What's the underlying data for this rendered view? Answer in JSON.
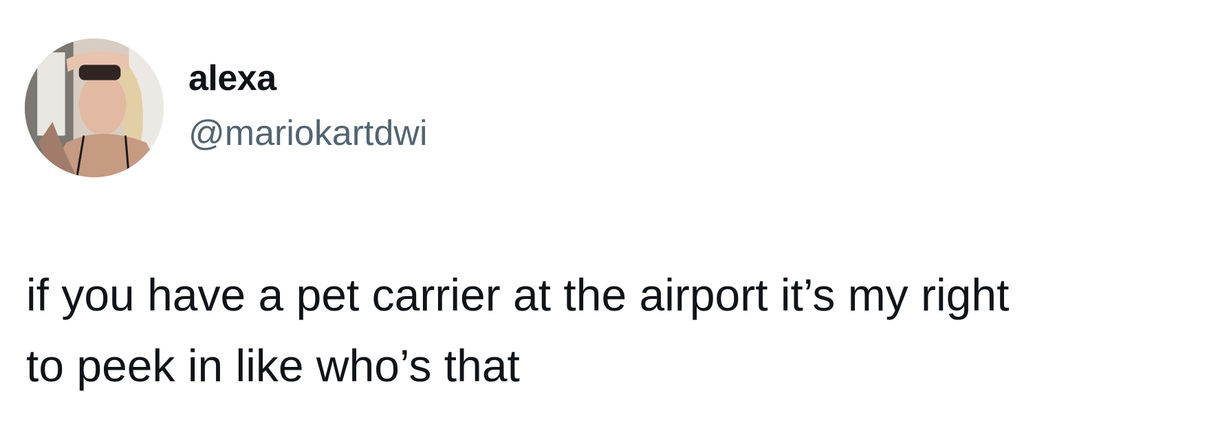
{
  "tweet": {
    "author": {
      "display_name": "alexa",
      "handle": "@mariokartdwi",
      "avatar_icon": "profile-photo"
    },
    "text_lines": [
      "if you have a pet carrier at the airport it’s my right",
      "to peek in like who’s that"
    ]
  },
  "colors": {
    "background": "#ffffff",
    "text": "#0f1419",
    "secondary_text": "#536471"
  }
}
